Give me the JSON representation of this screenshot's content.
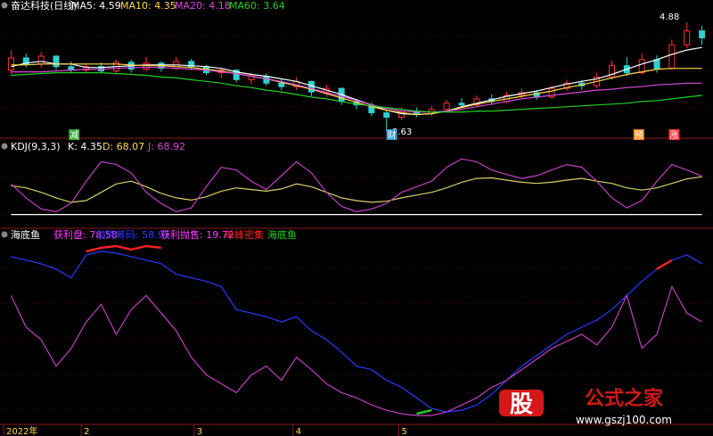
{
  "chart_data": [
    {
      "type": "candlestick",
      "title": "奋达科技(日线)",
      "legend": [
        {
          "label": "MA5: 4.59",
          "color": "#ffffff"
        },
        {
          "label": "MA10: 4.35",
          "color": "#ffd84a"
        },
        {
          "label": "MA20: 4.18",
          "color": "#d84ad8"
        },
        {
          "label": "MA60: 3.64",
          "color": "#23d023"
        }
      ],
      "y_range": [
        3.6,
        4.95
      ],
      "annotations": {
        "high_label": "4.88",
        "low_label": "3.63"
      },
      "badges": [
        {
          "text": "减",
          "color": "#3aa83a",
          "x": 0.1
        },
        {
          "text": "财",
          "color": "#3399cc",
          "x": 0.55
        },
        {
          "text": "预",
          "color": "#ff8c1a",
          "x": 0.9
        },
        {
          "text": "涨",
          "color": "#ff3333",
          "x": 0.95
        }
      ],
      "series": [
        {
          "name": "MA5",
          "color": "#ffffff",
          "values": [
            4.37,
            4.41,
            4.43,
            4.4,
            4.4,
            4.36,
            4.36,
            4.37,
            4.38,
            4.39,
            4.39,
            4.39,
            4.38,
            4.37,
            4.35,
            4.31,
            4.28,
            4.26,
            4.23,
            4.2,
            4.15,
            4.1,
            4.05,
            3.99,
            3.93,
            3.87,
            3.83,
            3.82,
            3.83,
            3.86,
            3.91,
            3.95,
            3.99,
            4.03,
            4.06,
            4.09,
            4.13,
            4.17,
            4.2,
            4.23,
            4.28,
            4.34,
            4.4,
            4.45,
            4.51,
            4.56,
            4.59
          ]
        },
        {
          "name": "MA10",
          "color": "#ffd84a",
          "values": [
            4.39,
            4.39,
            4.4,
            4.4,
            4.4,
            4.4,
            4.4,
            4.4,
            4.39,
            4.38,
            4.38,
            4.37,
            4.36,
            4.34,
            4.32,
            4.29,
            4.26,
            4.23,
            4.19,
            4.15,
            4.11,
            4.06,
            4.01,
            3.96,
            3.91,
            3.87,
            3.84,
            3.82,
            3.83,
            3.86,
            3.9,
            3.94,
            3.97,
            4.0,
            4.03,
            4.06,
            4.09,
            4.13,
            4.16,
            4.2,
            4.24,
            4.28,
            4.31,
            4.34,
            4.35,
            4.35,
            4.35
          ]
        },
        {
          "name": "MA20",
          "color": "#d84ad8",
          "values": [
            4.31,
            4.31,
            4.31,
            4.32,
            4.33,
            4.34,
            4.34,
            4.35,
            4.36,
            4.36,
            4.36,
            4.35,
            4.34,
            4.33,
            4.31,
            4.29,
            4.26,
            4.23,
            4.2,
            4.16,
            4.12,
            4.07,
            4.03,
            3.98,
            3.93,
            3.89,
            3.86,
            3.85,
            3.85,
            3.86,
            3.88,
            3.91,
            3.94,
            3.97,
            4.0,
            4.02,
            4.04,
            4.06,
            4.08,
            4.1,
            4.11,
            4.13,
            4.14,
            4.16,
            4.17,
            4.18,
            4.18
          ]
        },
        {
          "name": "MA60",
          "color": "#23d023",
          "values": [
            4.27,
            4.28,
            4.29,
            4.3,
            4.3,
            4.3,
            4.3,
            4.29,
            4.28,
            4.27,
            4.25,
            4.24,
            4.22,
            4.2,
            4.18,
            4.15,
            4.13,
            4.1,
            4.08,
            4.05,
            4.02,
            4.0,
            3.97,
            3.94,
            3.92,
            3.9,
            3.88,
            3.86,
            3.85,
            3.85,
            3.85,
            3.86,
            3.86,
            3.87,
            3.88,
            3.89,
            3.9,
            3.91,
            3.92,
            3.93,
            3.94,
            3.95,
            3.97,
            3.98,
            4.0,
            4.02,
            4.04
          ]
        }
      ],
      "candles": [
        {
          "o": 4.33,
          "c": 4.47,
          "h": 4.56,
          "l": 4.28
        },
        {
          "o": 4.47,
          "c": 4.4,
          "h": 4.52,
          "l": 4.36
        },
        {
          "o": 4.4,
          "c": 4.49,
          "h": 4.54,
          "l": 4.36
        },
        {
          "o": 4.49,
          "c": 4.37,
          "h": 4.5,
          "l": 4.33
        },
        {
          "o": 4.37,
          "c": 4.33,
          "h": 4.43,
          "l": 4.3
        },
        {
          "o": 4.33,
          "c": 4.37,
          "h": 4.41,
          "l": 4.29
        },
        {
          "o": 4.37,
          "c": 4.32,
          "h": 4.42,
          "l": 4.3
        },
        {
          "o": 4.32,
          "c": 4.42,
          "h": 4.45,
          "l": 4.3
        },
        {
          "o": 4.42,
          "c": 4.34,
          "h": 4.45,
          "l": 4.3
        },
        {
          "o": 4.34,
          "c": 4.41,
          "h": 4.48,
          "l": 4.32
        },
        {
          "o": 4.41,
          "c": 4.35,
          "h": 4.43,
          "l": 4.31
        },
        {
          "o": 4.35,
          "c": 4.43,
          "h": 4.48,
          "l": 4.33
        },
        {
          "o": 4.43,
          "c": 4.37,
          "h": 4.46,
          "l": 4.33
        },
        {
          "o": 4.37,
          "c": 4.3,
          "h": 4.39,
          "l": 4.27
        },
        {
          "o": 4.3,
          "c": 4.33,
          "h": 4.36,
          "l": 4.24
        },
        {
          "o": 4.33,
          "c": 4.22,
          "h": 4.34,
          "l": 4.19
        },
        {
          "o": 4.22,
          "c": 4.26,
          "h": 4.3,
          "l": 4.17
        },
        {
          "o": 4.26,
          "c": 4.18,
          "h": 4.29,
          "l": 4.15
        },
        {
          "o": 4.18,
          "c": 4.14,
          "h": 4.23,
          "l": 4.1
        },
        {
          "o": 4.14,
          "c": 4.2,
          "h": 4.25,
          "l": 4.1
        },
        {
          "o": 4.2,
          "c": 4.08,
          "h": 4.21,
          "l": 4.03
        },
        {
          "o": 4.08,
          "c": 4.12,
          "h": 4.16,
          "l": 4.02
        },
        {
          "o": 4.12,
          "c": 3.97,
          "h": 4.13,
          "l": 3.93
        },
        {
          "o": 3.97,
          "c": 3.93,
          "h": 4.0,
          "l": 3.88
        },
        {
          "o": 3.93,
          "c": 3.84,
          "h": 3.96,
          "l": 3.8
        },
        {
          "o": 3.84,
          "c": 3.79,
          "h": 3.87,
          "l": 3.63
        },
        {
          "o": 3.79,
          "c": 3.86,
          "h": 3.9,
          "l": 3.76
        },
        {
          "o": 3.86,
          "c": 3.83,
          "h": 3.9,
          "l": 3.79
        },
        {
          "o": 3.83,
          "c": 3.88,
          "h": 3.92,
          "l": 3.8
        },
        {
          "o": 3.88,
          "c": 3.95,
          "h": 3.99,
          "l": 3.85
        },
        {
          "o": 3.95,
          "c": 3.93,
          "h": 4.01,
          "l": 3.9
        },
        {
          "o": 3.93,
          "c": 4.0,
          "h": 4.04,
          "l": 3.91
        },
        {
          "o": 4.0,
          "c": 3.97,
          "h": 4.05,
          "l": 3.93
        },
        {
          "o": 3.97,
          "c": 4.04,
          "h": 4.08,
          "l": 3.95
        },
        {
          "o": 4.04,
          "c": 4.07,
          "h": 4.12,
          "l": 4.01
        },
        {
          "o": 4.07,
          "c": 4.02,
          "h": 4.1,
          "l": 3.99
        },
        {
          "o": 4.02,
          "c": 4.12,
          "h": 4.15,
          "l": 4.0
        },
        {
          "o": 4.12,
          "c": 4.18,
          "h": 4.22,
          "l": 4.09
        },
        {
          "o": 4.18,
          "c": 4.15,
          "h": 4.22,
          "l": 4.1
        },
        {
          "o": 4.15,
          "c": 4.25,
          "h": 4.3,
          "l": 4.12
        },
        {
          "o": 4.25,
          "c": 4.38,
          "h": 4.44,
          "l": 4.22
        },
        {
          "o": 4.38,
          "c": 4.3,
          "h": 4.48,
          "l": 4.26
        },
        {
          "o": 4.3,
          "c": 4.45,
          "h": 4.52,
          "l": 4.28
        },
        {
          "o": 4.45,
          "c": 4.35,
          "h": 4.5,
          "l": 4.3
        },
        {
          "o": 4.35,
          "c": 4.62,
          "h": 4.68,
          "l": 4.33
        },
        {
          "o": 4.62,
          "c": 4.78,
          "h": 4.88,
          "l": 4.58
        },
        {
          "o": 4.78,
          "c": 4.7,
          "h": 4.84,
          "l": 4.62
        }
      ]
    },
    {
      "type": "line",
      "title": "KDJ(9,3,3)",
      "legend": [
        {
          "label": "K: 4.35",
          "color": "#ffffff"
        },
        {
          "label": "D: 68.07",
          "color": "#ffd84a"
        },
        {
          "label": "J: 68.92",
          "color": "#d84ad8"
        }
      ],
      "y_range": [
        -15,
        110
      ],
      "series": [
        {
          "name": "D",
          "color": "#d8d066",
          "values": [
            52,
            48,
            40,
            30,
            22,
            25,
            40,
            55,
            60,
            50,
            38,
            30,
            26,
            32,
            42,
            48,
            45,
            42,
            46,
            55,
            50,
            40,
            30,
            25,
            22,
            24,
            30,
            35,
            40,
            48,
            58,
            65,
            66,
            62,
            58,
            56,
            58,
            62,
            65,
            60,
            56,
            48,
            44,
            48,
            56,
            64,
            68
          ]
        },
        {
          "name": "J",
          "color": "#c040c0",
          "values": [
            55,
            30,
            10,
            5,
            20,
            60,
            95,
            90,
            75,
            40,
            20,
            5,
            12,
            50,
            85,
            80,
            60,
            45,
            70,
            95,
            75,
            40,
            15,
            5,
            10,
            20,
            40,
            50,
            60,
            85,
            100,
            95,
            80,
            72,
            65,
            70,
            80,
            90,
            85,
            60,
            30,
            12,
            25,
            60,
            90,
            80,
            69
          ]
        },
        {
          "name": "baseline",
          "color": "#ffffff",
          "values": [
            0,
            0,
            0,
            0,
            0,
            0,
            0,
            0,
            0,
            0,
            0,
            0,
            0,
            0,
            0,
            0,
            0,
            0,
            0,
            0,
            0,
            0,
            0,
            0,
            0,
            0,
            0,
            0,
            0,
            0,
            0,
            0,
            0,
            0,
            0,
            0,
            0,
            0,
            0,
            0,
            0,
            0,
            0,
            0,
            0,
            0,
            0
          ]
        }
      ]
    },
    {
      "type": "line",
      "title": "海底鱼",
      "legend": [
        {
          "label": "获利盘: 78.58",
          "color": "#ff3fff"
        },
        {
          "label": "趋势筹码: 58.95",
          "color": "#2a3aff"
        },
        {
          "label": "获利抛售: 19.72",
          "color": "#ff3fff"
        },
        {
          "label": "单峰密集",
          "color": "#ff2020"
        },
        {
          "label": "海底鱼",
          "color": "#23d023"
        }
      ],
      "y_range": [
        0,
        100
      ],
      "x_labels": [
        {
          "text": "2022年",
          "x": 0.0
        },
        {
          "text": "2",
          "x": 0.11
        },
        {
          "text": "3",
          "x": 0.27
        },
        {
          "text": "4",
          "x": 0.41
        },
        {
          "text": "5",
          "x": 0.56
        }
      ],
      "series": [
        {
          "name": "趋势筹码",
          "color": "#2a3aff",
          "values": [
            92,
            90,
            88,
            85,
            80,
            93,
            95,
            94,
            92,
            90,
            88,
            82,
            80,
            78,
            75,
            62,
            60,
            58,
            55,
            58,
            50,
            45,
            38,
            30,
            28,
            22,
            18,
            12,
            6,
            4,
            5,
            8,
            14,
            22,
            30,
            36,
            42,
            48,
            52,
            56,
            62,
            70,
            78,
            85,
            90,
            93,
            88
          ]
        },
        {
          "name": "获利盘",
          "color": "#c040c0",
          "values": [
            70,
            52,
            45,
            30,
            40,
            55,
            65,
            48,
            62,
            70,
            60,
            50,
            35,
            25,
            20,
            15,
            25,
            30,
            22,
            35,
            28,
            20,
            15,
            12,
            8,
            5,
            3,
            2,
            2,
            4,
            8,
            12,
            18,
            22,
            28,
            34,
            40,
            44,
            48,
            42,
            52,
            70,
            40,
            48,
            75,
            60,
            55
          ]
        },
        {
          "name": "单峰密集",
          "color": "#ff2020",
          "values": [
            null,
            null,
            null,
            null,
            null,
            95,
            97,
            98,
            96,
            98,
            97,
            null,
            null,
            null,
            null,
            null,
            null,
            null,
            null,
            null,
            null,
            null,
            null,
            null,
            null,
            null,
            null,
            null,
            null,
            null,
            null,
            null,
            null,
            null,
            null,
            null,
            null,
            null,
            null,
            null,
            null,
            null,
            null,
            85,
            90,
            null,
            null
          ]
        },
        {
          "name": "海底鱼",
          "color": "#23d023",
          "values": [
            null,
            null,
            null,
            null,
            null,
            null,
            null,
            null,
            null,
            null,
            null,
            null,
            null,
            null,
            null,
            null,
            null,
            null,
            null,
            null,
            null,
            null,
            null,
            null,
            null,
            null,
            null,
            3,
            5,
            null,
            null,
            null,
            null,
            null,
            null,
            null,
            null,
            null,
            null,
            null,
            null,
            null,
            null,
            null,
            null,
            null,
            null
          ]
        }
      ]
    }
  ],
  "watermark": {
    "logo_char": "股",
    "text": "公式之家",
    "url": "www.gszj100.com"
  }
}
